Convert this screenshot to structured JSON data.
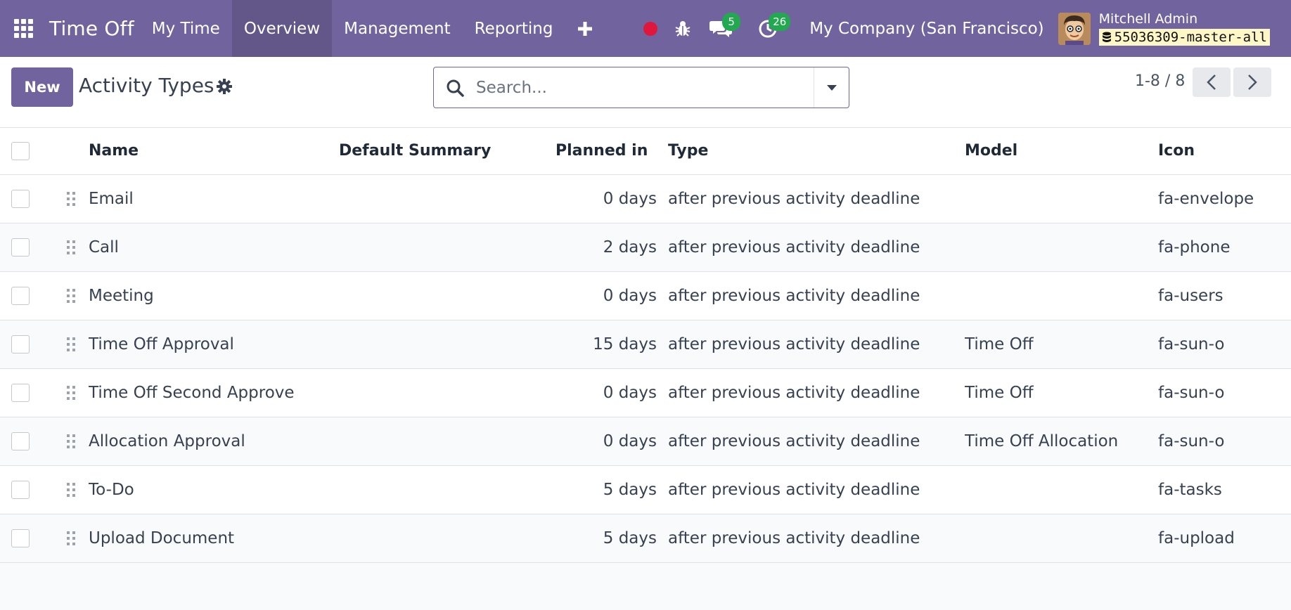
{
  "navbar": {
    "app_name": "Time Off",
    "menu": [
      "My Time",
      "Overview",
      "Management",
      "Reporting"
    ],
    "active_menu": "Overview",
    "messages_count": "5",
    "activities_count": "26",
    "company": "My Company (San Francisco)",
    "user_name": "Mitchell Admin",
    "database": "55036309-master-all"
  },
  "control_panel": {
    "new_label": "New",
    "title": "Activity Types",
    "search_placeholder": "Search...",
    "pager": "1-8 / 8"
  },
  "table": {
    "columns": {
      "name": "Name",
      "summary": "Default Summary",
      "planned": "Planned in",
      "type": "Type",
      "model": "Model",
      "icon": "Icon"
    },
    "rows": [
      {
        "name": "Email",
        "summary": "",
        "planned": "0 days",
        "type": "after previous activity deadline",
        "model": "",
        "icon": "fa-envelope"
      },
      {
        "name": "Call",
        "summary": "",
        "planned": "2 days",
        "type": "after previous activity deadline",
        "model": "",
        "icon": "fa-phone"
      },
      {
        "name": "Meeting",
        "summary": "",
        "planned": "0 days",
        "type": "after previous activity deadline",
        "model": "",
        "icon": "fa-users"
      },
      {
        "name": "Time Off Approval",
        "summary": "",
        "planned": "15 days",
        "type": "after previous activity deadline",
        "model": "Time Off",
        "icon": "fa-sun-o"
      },
      {
        "name": "Time Off Second Approve",
        "summary": "",
        "planned": "0 days",
        "type": "after previous activity deadline",
        "model": "Time Off",
        "icon": "fa-sun-o"
      },
      {
        "name": "Allocation Approval",
        "summary": "",
        "planned": "0 days",
        "type": "after previous activity deadline",
        "model": "Time Off Allocation",
        "icon": "fa-sun-o"
      },
      {
        "name": "To-Do",
        "summary": "",
        "planned": "5 days",
        "type": "after previous activity deadline",
        "model": "",
        "icon": "fa-tasks"
      },
      {
        "name": "Upload Document",
        "summary": "",
        "planned": "5 days",
        "type": "after previous activity deadline",
        "model": "",
        "icon": "fa-upload"
      }
    ]
  },
  "colors": {
    "brand": "#71639e",
    "badge": "#22a94f",
    "record": "#e0173a"
  },
  "icons": [
    "apps-grid-icon",
    "plus-icon",
    "record-icon",
    "bug-icon",
    "chat-icon",
    "clock-icon",
    "database-icon",
    "gear-icon",
    "search-icon",
    "caret-down-icon",
    "chevron-left-icon",
    "chevron-right-icon",
    "drag-handle-icon"
  ]
}
